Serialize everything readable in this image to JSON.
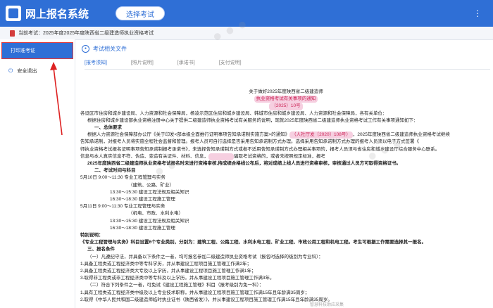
{
  "header": {
    "app_title": "网上报名系统",
    "select_exam_label": "选择考试"
  },
  "subbar": {
    "current_exam": "当前考试：2025年度2025年度陕西省二级建造师执业资格考试"
  },
  "sidebar": {
    "items": [
      {
        "label": "打印准考证"
      },
      {
        "label": "安全退出"
      }
    ]
  },
  "main": {
    "section_title": "考试相关文件",
    "tabs": [
      {
        "label": "[报考须知]"
      },
      {
        "label": "[照片说明]"
      },
      {
        "label": "[承诺书]"
      },
      {
        "label": "[支付说明]"
      }
    ]
  },
  "notice": {
    "title": "关于做好2025年度陕西省二级建造师",
    "subtitle": "执业资格考试有关事项的通知",
    "doc_no": "（2025）10号",
    "lines": [
      "各设区市住房和城乡建设局、人力资源和社会保障局，杨凌示范区住房和城乡建设局、韩城市住房和城乡建设局、人力资源和社会保障局，各有关单位：",
      "根据住房和城乡建设部执业资格注册中心关于提供二级建造师执业资格考试有关服务的说明，现就2025年度陕西省二级建造师执业资格考试工作有关事项通知如下：",
      "一、总体要求",
      "根据人力资源社会保障部办公厅《关于印发<部本级全面推行证明事项告知承诺制实施方案>的通知》",
      "（人社厅发〔2020〕108号）",
      "，2025年度陕西省二级建造师执业资格考试继续",
      "告知承诺制，对报考人员将实施全程社会监督和管理。报考人员可自行选择是否采用告知承诺制方式办理。选择采用告知承诺制方式办理的报考人员须以电子方式签署《",
      "师执业资格考试报名证明事项告知承诺制报考承诺书》，未选择告知承诺制方式或者不适用告知承诺制方式办理相关事项的，报考人员须与省住房和城乡建设厅综合服务中心联系。",
      "信息与本人真实信息不符、伪造、变造有关证件、材料、信息，",
      "骗取考试资格的，或者未按照规定标准，报考",
      "2025年度陕西省二级建造师执业资格考试报名时未进行资格审核,待成绩合格线公布后，将对成绩上线人员进行资格审核，审核通过人员方可取得资格证书。",
      "二、考试时间与科目",
      "5月10日 9:00～11:30 专业工程管理与实务",
      "（建筑、公路、矿业）",
      "13:30～15:30 建设工程法规及相关知识",
      "16:30～18:30 建设工程施工管理",
      "5月11日 9:00～11:30 专业工程管理与实务",
      "（机电、市政、水利水电）",
      "13:30～15:30 建设工程法规及相关知识",
      "16:30～18:30 建设工程施工管理",
      "特别说明：",
      "《专业工程管理与实务》科目设置6个专业类别，分别为：建筑工程、公路工程、水利水电工程、矿业工程、市政公用工程和机电工程。考生可根据工作需要选择其一报名。",
      "三、报名条件",
      "（一）凡遵纪守法，并具备以下条件之一者，均可报名参加二级建造师执业资格考试（报名时选择的级别为专业科）：",
      "1.具备工程类或工程经济类中等专科学历，并从事建设工程项目施工管理工作满2年；",
      "2.具备工程类或工程经济类大专及以上学历，并从事建设工程项目施工管理工作满1年；",
      "3.取得非工程类或非工程经济类中等专科及以上学历，并从事建设工程项目施工管理工作满3年。",
      "（二）符合下列条件之一者，可免试《建设工程施工管理》科目（报考级别为免一科）：",
      "1.具有工程类或工程经济类中级及以上专业技术职称，并从事建设工程项目施工管理工作满15年且年龄满35周岁；",
      "2.取得《中华人民共和国二级建造师临时执业证书（陕西省发）》，并从事建设工程项目施工管理工作满15年且年龄满35周岁。"
    ]
  },
  "footer": {
    "mark": "智慧科技助应采集"
  }
}
